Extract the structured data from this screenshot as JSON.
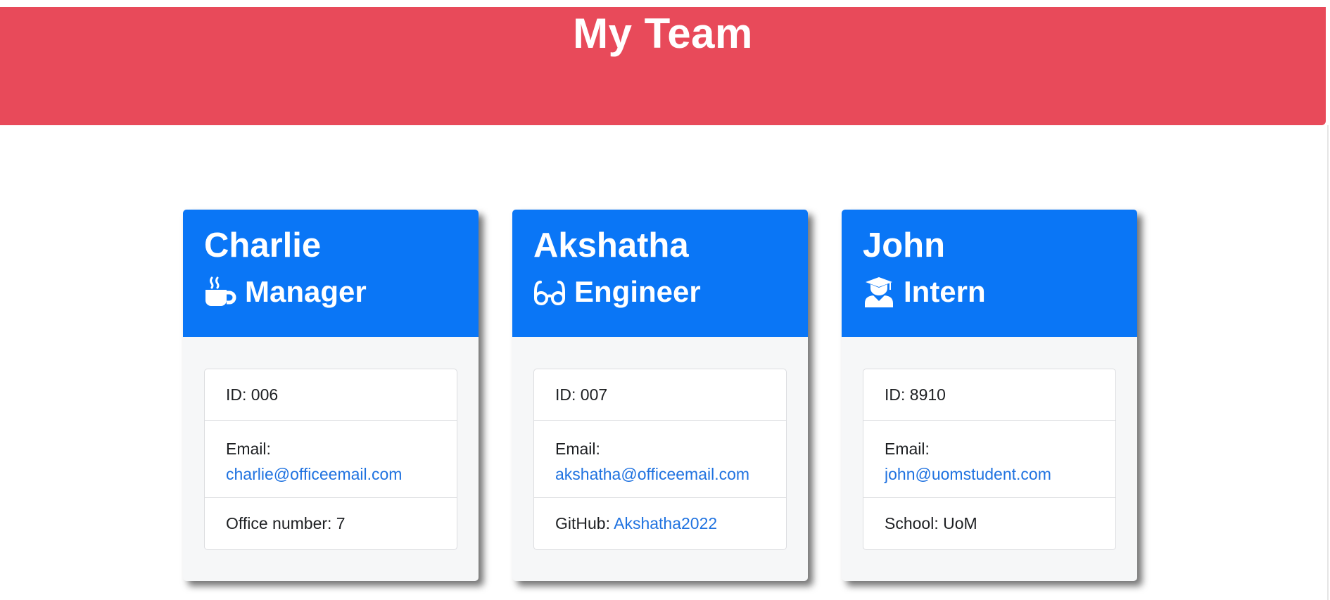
{
  "header": {
    "title": "My Team"
  },
  "colors": {
    "header_bg": "#e84a5a",
    "card_head_bg": "#0a76f6",
    "link": "#1f72e0"
  },
  "cards": [
    {
      "name": "Charlie",
      "role": "Manager",
      "role_icon": "mug-hot-icon",
      "id_text": "ID: 006",
      "email_label": "Email:",
      "email": "charlie@officeemail.com",
      "extra_label": "Office number: 7",
      "extra_link": ""
    },
    {
      "name": "Akshatha",
      "role": "Engineer",
      "role_icon": "glasses-icon",
      "id_text": "ID: 007",
      "email_label": "Email:",
      "email": "akshatha@officeemail.com",
      "extra_label": "GitHub: ",
      "extra_link": "Akshatha2022"
    },
    {
      "name": "John",
      "role": "Intern",
      "role_icon": "graduate-user-icon",
      "id_text": "ID: 8910",
      "email_label": "Email:",
      "email": "john@uomstudent.com",
      "extra_label": "School: UoM",
      "extra_link": ""
    }
  ]
}
